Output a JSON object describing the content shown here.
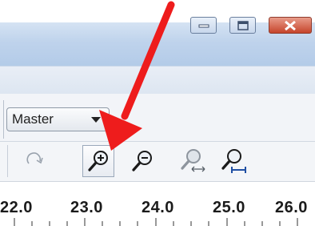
{
  "window": {
    "controls": {
      "minimize_icon": "minimize-icon",
      "maximize_icon": "maximize-icon",
      "close_icon": "close-icon",
      "close_color": "#c6452c"
    }
  },
  "toolbar": {
    "selector": {
      "value": "Master"
    },
    "tools": [
      {
        "name": "redo-icon"
      },
      {
        "name": "zoom-in-icon",
        "pressed": true
      },
      {
        "name": "zoom-out-icon"
      },
      {
        "name": "zoom-fit-icon"
      },
      {
        "name": "zoom-selection-icon"
      }
    ]
  },
  "ruler": {
    "labels": [
      "22.0",
      "23.0",
      "24.0",
      "25.0",
      "26.0"
    ]
  },
  "annotation": {
    "arrow_color": "#ee1c1c"
  }
}
